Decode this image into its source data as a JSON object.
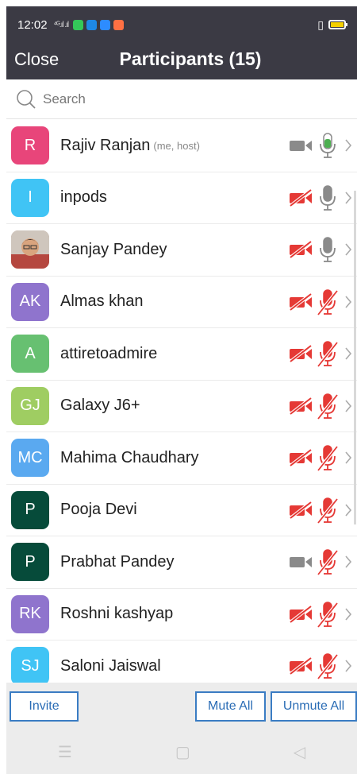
{
  "status_bar": {
    "time": "12:02",
    "signal_text": "⁴ᴳ.ıl .ıl",
    "colors": {
      "bg": "#3b3a44",
      "battery": "#f5d000"
    }
  },
  "header": {
    "close_label": "Close",
    "title": "Participants (15)"
  },
  "search": {
    "placeholder": "Search"
  },
  "participants": [
    {
      "initials": "R",
      "name": "Rajiv Ranjan",
      "tag": "(me, host)",
      "color": "#e8457a",
      "video": "on",
      "audio": "on",
      "photo": false
    },
    {
      "initials": "I",
      "name": "inpods",
      "tag": "",
      "color": "#40c4f5",
      "video": "off",
      "audio": "idle",
      "photo": false
    },
    {
      "initials": "",
      "name": "Sanjay Pandey",
      "tag": "",
      "color": "#b08a79",
      "video": "off",
      "audio": "idle",
      "photo": true
    },
    {
      "initials": "AK",
      "name": "Almas khan",
      "tag": "",
      "color": "#8f74cd",
      "video": "off",
      "audio": "off",
      "photo": false
    },
    {
      "initials": "A",
      "name": "attiretoadmire",
      "tag": "",
      "color": "#67c071",
      "video": "off",
      "audio": "off",
      "photo": false
    },
    {
      "initials": "GJ",
      "name": "Galaxy J6+",
      "tag": "",
      "color": "#9fcd62",
      "video": "off",
      "audio": "off",
      "photo": false
    },
    {
      "initials": "MC",
      "name": "Mahima Chaudhary",
      "tag": "",
      "color": "#5aa9f0",
      "video": "off",
      "audio": "off",
      "photo": false
    },
    {
      "initials": "P",
      "name": "Pooja Devi",
      "tag": "",
      "color": "#064b3a",
      "video": "off",
      "audio": "off",
      "photo": false
    },
    {
      "initials": "P",
      "name": "Prabhat Pandey",
      "tag": "",
      "color": "#064b3a",
      "video": "idle",
      "audio": "off",
      "photo": false
    },
    {
      "initials": "RK",
      "name": "Roshni kashyap",
      "tag": "",
      "color": "#8f74cd",
      "video": "off",
      "audio": "off",
      "photo": false
    },
    {
      "initials": "SJ",
      "name": "Saloni Jaiswal",
      "tag": "",
      "color": "#40c4f5",
      "video": "off",
      "audio": "off",
      "photo": false
    }
  ],
  "footer": {
    "invite_label": "Invite",
    "mute_all_label": "Mute All",
    "unmute_all_label": "Unmute All"
  },
  "nav": {
    "menu_icon": "☰",
    "home_icon": "▢",
    "back_icon": "◁"
  },
  "icon_colors": {
    "muted_red": "#e53935",
    "idle_gray": "#8a8a8a",
    "active_green": "#4caf50"
  }
}
